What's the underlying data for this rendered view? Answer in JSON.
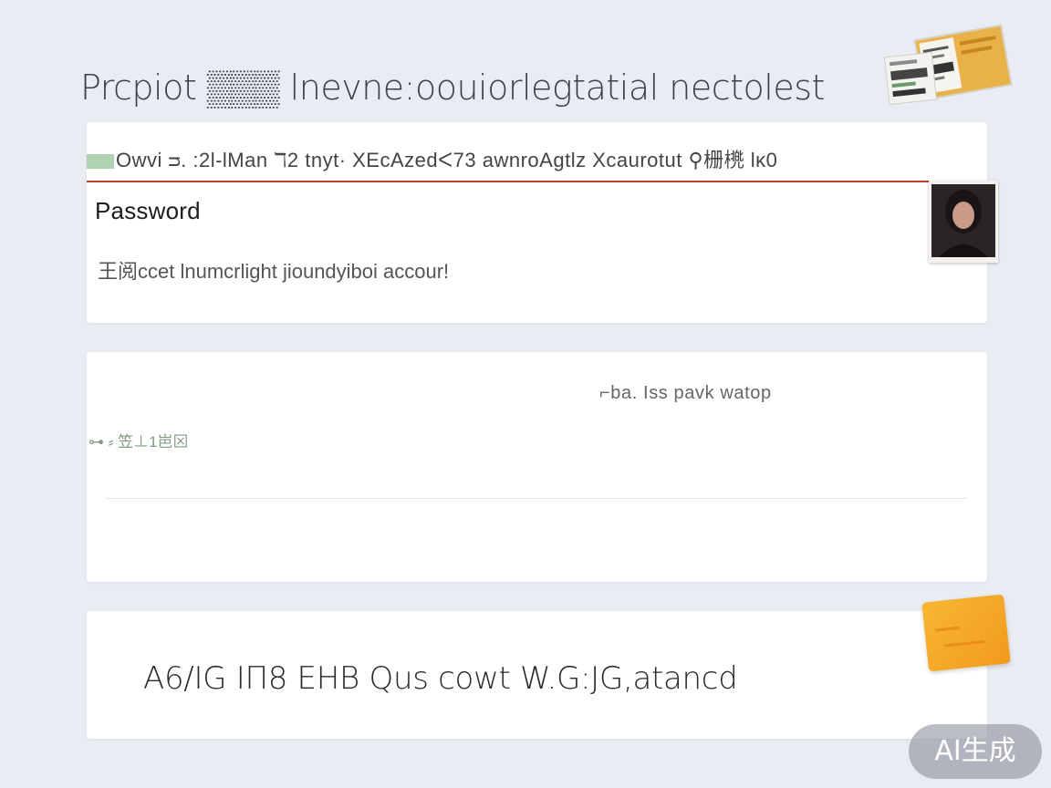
{
  "page": {
    "title": "Prcpiot ▒▒▒ lnevne:oouiorlegtatial nectolest"
  },
  "card1": {
    "banner_text": "Owvi ᴝ. :2l-lMan ℸ2 tnyt· XEcAzedᐸ73 awnroAgtlz Xcaurotut ⚲栅橷 lκ0",
    "password_label": "Password",
    "help_text": "王阅ccet lnumcrlight jioundyiboi accour!"
  },
  "card2": {
    "right_text": "⌐ba. Iss pavk watop",
    "left_text": "⊶ ⸗ 笠⊥1岜⊠"
  },
  "card3": {
    "text": "A6/IG ΙΠ8 ΕΗΒ Qus cowt W.G:JG,atancd"
  },
  "badge": {
    "label": "AI生成"
  },
  "colors": {
    "background": "#eaecf4",
    "card": "#ffffff",
    "banner_rule": "#c0392b",
    "sticky_note": "#f29a1c"
  },
  "icons": {
    "top_sticker": "product-label-sticker-image",
    "photo": "portrait-photo",
    "note": "orange-sticky-note"
  }
}
